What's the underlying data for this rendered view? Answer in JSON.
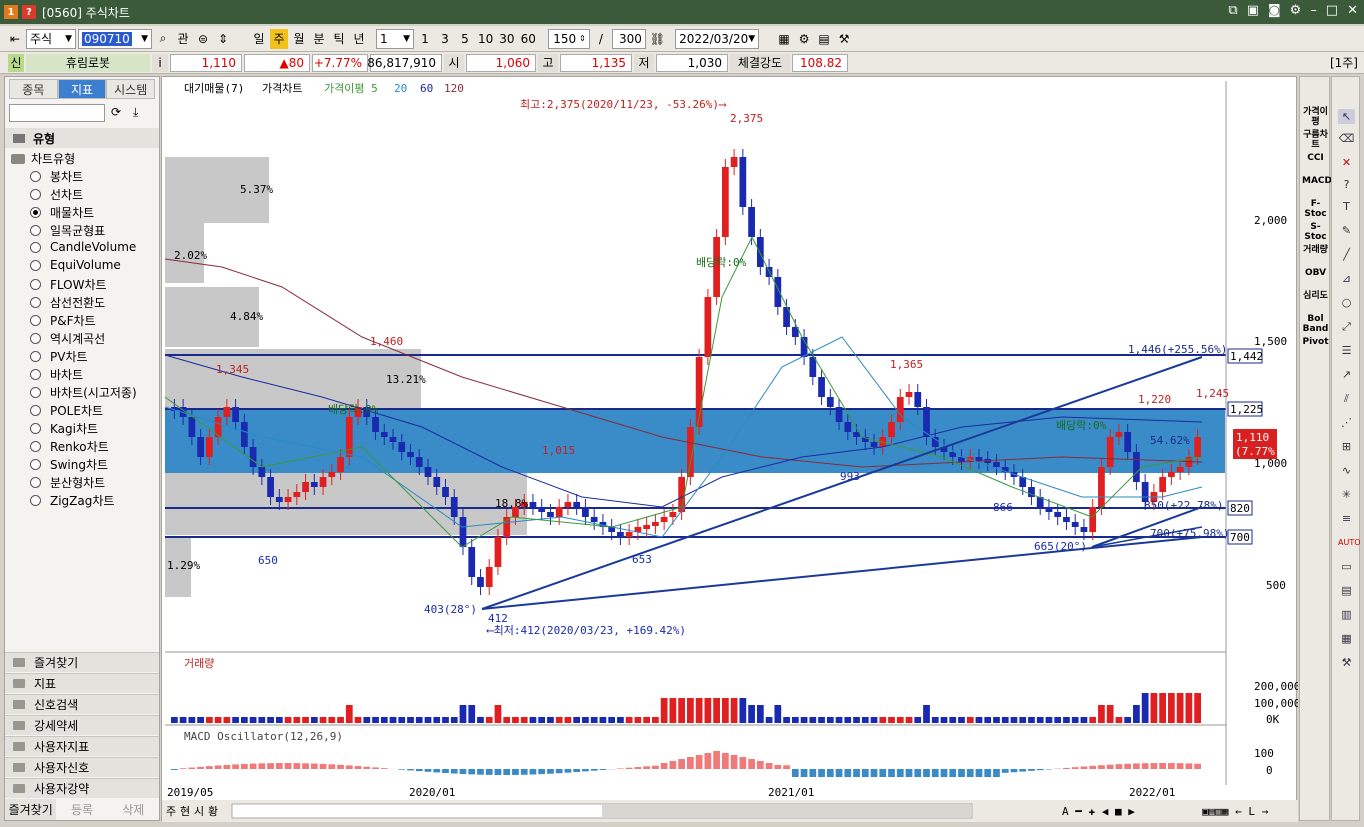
{
  "window": {
    "title": "[0560] 주식차트",
    "icon1": "1",
    "icon2": "?"
  },
  "toolbar": {
    "market": "주식",
    "code": "090710",
    "gwan": "관",
    "periods": [
      "일",
      "주",
      "월",
      "분",
      "틱",
      "년"
    ],
    "active_period": "주",
    "unit": "1",
    "nums": [
      "1",
      "3",
      "5",
      "10",
      "30",
      "60"
    ],
    "count": "150",
    "slash": "/",
    "total": "300",
    "date": "2022/03/20"
  },
  "info": {
    "badge": "신",
    "name": "휴림로봇",
    "i": "i",
    "price": "1,110",
    "change": "▲80",
    "rate": "+7.77%",
    "volume": "86,817,910",
    "open_label": "시",
    "open": "1,060",
    "high_label": "고",
    "high": "1,135",
    "low_label": "저",
    "low": "1,030",
    "strength_label": "체결강도",
    "strength": "108.82",
    "period_badge": "[1주]"
  },
  "left": {
    "tabs": [
      "종목",
      "지표",
      "시스템"
    ],
    "active_tab": "지표",
    "section": "유형",
    "tree_root": "차트유형",
    "types": [
      "봉차트",
      "선차트",
      "매물차트",
      "일목균형표",
      "CandleVolume",
      "EquiVolume",
      "FLOW차트",
      "삼선전환도",
      "P&F차트",
      "역시계곡선",
      "PV차트",
      "바차트",
      "바차트(시고저종)",
      "POLE차트",
      "Kagi차트",
      "Renko차트",
      "Swing차트",
      "분산형차트",
      "ZigZag차트"
    ],
    "selected": "매물차트",
    "accordion": [
      "즐겨찾기",
      "지표",
      "신호검색",
      "강세약세",
      "사용자지표",
      "사용자신호",
      "사용자강약"
    ],
    "bottom": [
      "즐겨찾기",
      "등록",
      "삭제"
    ]
  },
  "chart": {
    "legend": [
      "대기매물(7)",
      "가격차트",
      "가격이평 5",
      "20",
      "60",
      "120"
    ],
    "legend_colors": [
      "#222",
      "#222",
      "#3a9a3a",
      "#2a8ac4",
      "#1a2aa0",
      "#8a2a3a"
    ],
    "vp_labels": [
      "5.37%",
      "2.02%",
      "4.84%",
      "13.21%",
      "18.8%",
      "1.29%"
    ],
    "annotations": {
      "high_note": "최고:2,375(2020/11/23, -53.26%)⟶",
      "high": "2,375",
      "low_note": "⟵최저:412(2020/03/23, +169.42%)",
      "low": "412",
      "p1345": "1,345",
      "p1460": "1,460",
      "p650": "650",
      "p1015": "1,015",
      "p653": "653",
      "p1365": "1,365",
      "p993": "993",
      "p866": "866",
      "p1220": "1,220",
      "p1245": "1,245",
      "p665": "665(20°)",
      "p403": "403(28°)",
      "pct5462": "54.62%",
      "div1": "배당락:0%",
      "div2": "배당락:0%",
      "div3": "배당락:0%",
      "line1446": "1,446(+255.56%)",
      "line850": "850(+22.78%)",
      "line700": "700(+75.98%)"
    },
    "y_ticks": [
      "2,000",
      "1,500",
      "1,000",
      "500"
    ],
    "price_tags": [
      "1,442",
      "1,225",
      "820",
      "700"
    ],
    "current_tag": [
      "1,110",
      "(7.77%)"
    ],
    "vol_title": "거래량",
    "vol_ticks": [
      "200,000K",
      "100,000K",
      "0K"
    ],
    "macd_title": "MACD Oscillator(12,26,9)",
    "macd_ticks": [
      "100",
      "0"
    ],
    "x_labels": [
      "2019/05",
      "2020/01",
      "2021/01",
      "2022/01"
    ],
    "bottom_tabs": [
      "주",
      "현",
      "시",
      "황"
    ]
  },
  "right_tools": [
    "가격이평",
    "구름차트",
    "CCI",
    "MACD",
    "F-Stoc",
    "S-Stoc",
    "거래량",
    "OBV",
    "심리도",
    "Bol Band",
    "Pivot"
  ],
  "colors": {
    "up": "#e02020",
    "down": "#1a2ab0",
    "band": "#3a8cc8",
    "grey": "#c8c8c8"
  }
}
